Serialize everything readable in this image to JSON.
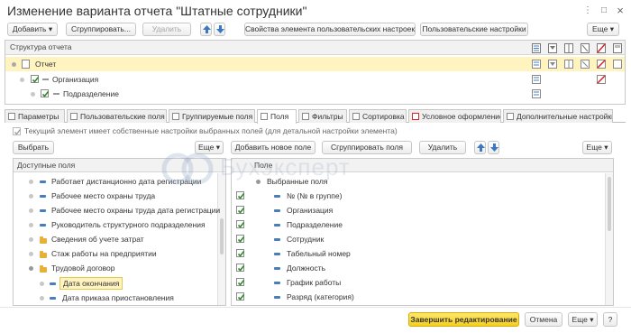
{
  "window": {
    "title": "Изменение варианта отчета \"Штатные сотрудники\"",
    "menu_glyph": "⋮",
    "maximize_glyph": "□",
    "close_glyph": "×"
  },
  "toolbar": {
    "add_label": "Добавить",
    "group_label": "Сгруппировать...",
    "delete_label": "Удалить",
    "element_props_label": "Свойства элемента пользовательских настроек",
    "user_settings_label": "Пользовательские настройки",
    "more_label": "Еще"
  },
  "structure": {
    "header": "Структура отчета",
    "rows": [
      {
        "label": "Отчет",
        "level": 0
      },
      {
        "label": "Организация",
        "level": 1
      },
      {
        "label": "Подразделение",
        "level": 2
      }
    ]
  },
  "tabs": [
    {
      "label": "Параметры"
    },
    {
      "label": "Пользовательские поля"
    },
    {
      "label": "Группируемые поля"
    },
    {
      "label": "Поля"
    },
    {
      "label": "Фильтры"
    },
    {
      "label": "Сортировка"
    },
    {
      "label": "Условное оформление"
    },
    {
      "label": "Дополнительные настройки"
    }
  ],
  "fields_tab": {
    "own_settings_label": "Текущий элемент имеет собственные настройки выбранных полей (для детальной настройки элемента)",
    "select_label": "Выбрать",
    "more_label": "Еще",
    "add_new_label": "Добавить новое поле",
    "group_fields_label": "Сгруппировать поля",
    "delete_label": "Удалить",
    "more2_label": "Еще"
  },
  "available_fields": {
    "header": "Доступные поля",
    "items": [
      {
        "label": "Работает дистанционно дата регистрации",
        "kind": "field"
      },
      {
        "label": "Рабочее место охраны труда",
        "kind": "field"
      },
      {
        "label": "Рабочее место охраны труда дата регистрации",
        "kind": "field"
      },
      {
        "label": "Руководитель структурного подразделения",
        "kind": "field"
      },
      {
        "label": "Сведения об учете затрат",
        "kind": "folder"
      },
      {
        "label": "Стаж работы на предприятии",
        "kind": "folder"
      },
      {
        "label": "Трудовой договор",
        "kind": "folder"
      },
      {
        "label": "Дата окончания",
        "kind": "child-selected"
      },
      {
        "label": "Дата приказа приостановления",
        "kind": "child"
      }
    ]
  },
  "selected_fields": {
    "header": "Поле",
    "root_label": "Выбранные поля",
    "items": [
      {
        "label": "№ (№ в группе)"
      },
      {
        "label": "Организация"
      },
      {
        "label": "Подразделение"
      },
      {
        "label": "Сотрудник"
      },
      {
        "label": "Табельный номер"
      },
      {
        "label": "Должность"
      },
      {
        "label": "График работы"
      },
      {
        "label": "Разряд (категория)"
      }
    ]
  },
  "footer": {
    "finish_label": "Завершить редактирование",
    "cancel_label": "Отмена",
    "more_label": "Еще",
    "help_label": "?"
  },
  "watermark": {
    "text": "Бухэксперт"
  },
  "colors": {
    "accent_yellow": "#f5cf1d",
    "selected_row": "#fff3bf",
    "check_green": "#2e8b2e",
    "field_dash": "#4a7cc0",
    "folder": "#e8b03a"
  }
}
